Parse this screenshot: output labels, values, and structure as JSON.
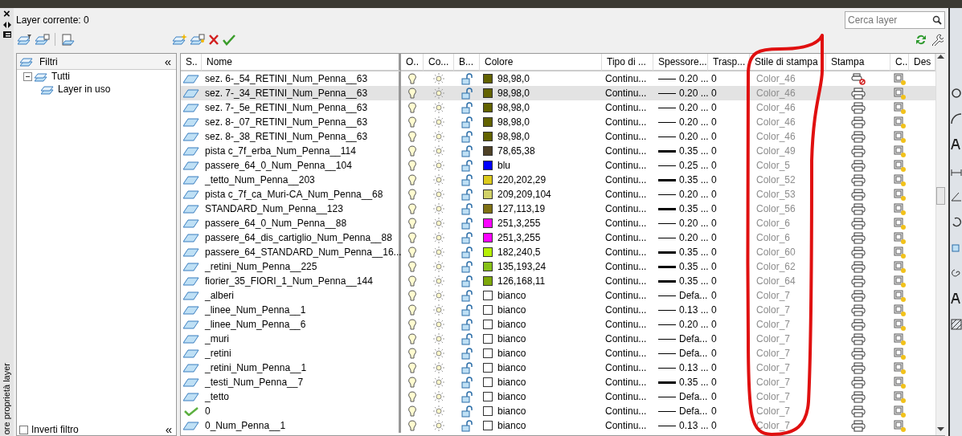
{
  "side_strip": {
    "close": "×",
    "caption": "ore proprietà layer"
  },
  "header": {
    "current_layer": "Layer corrente: 0",
    "search": {
      "placeholder": "Cerca layer"
    }
  },
  "filters": {
    "title": "Filtri",
    "collapse": "«",
    "tree": [
      {
        "label": "Tutti",
        "expanded": true,
        "children": [
          {
            "label": "Layer in uso"
          }
        ]
      }
    ],
    "invert": {
      "label": "Inverti filtro",
      "checked": false,
      "collapse": "«"
    }
  },
  "table": {
    "columns": [
      "S..",
      "Nome",
      "O..",
      "Co...",
      "B...",
      "Colore",
      "Tipo di ...",
      "Spessore...",
      "Trasp...",
      "Stile di stampa",
      "Stampa",
      "C..",
      "Des"
    ],
    "rows": [
      {
        "kind": "layer",
        "name": "sez. 6-_54_RETINI_Num_Penna__63",
        "on": true,
        "frozen": false,
        "locked": false,
        "color": "#626200",
        "color_label": "98,98,0",
        "linetype": "Continu...",
        "line_bold": false,
        "lineweight": "0.20 ...",
        "transparency": "0",
        "plot_style": "Color_46",
        "plot": false,
        "selected": false
      },
      {
        "kind": "layer",
        "name": "sez. 7-_34_RETINI_Num_Penna__63",
        "on": true,
        "frozen": false,
        "locked": false,
        "color": "#626200",
        "color_label": "98,98,0",
        "linetype": "Continu...",
        "line_bold": false,
        "lineweight": "0.20 ...",
        "transparency": "0",
        "plot_style": "Color_46",
        "plot": true,
        "selected": true
      },
      {
        "kind": "layer",
        "name": "sez. 7-_5e_RETINI_Num_Penna__63",
        "on": true,
        "frozen": false,
        "locked": false,
        "color": "#626200",
        "color_label": "98,98,0",
        "linetype": "Continu...",
        "line_bold": false,
        "lineweight": "0.20 ...",
        "transparency": "0",
        "plot_style": "Color_46",
        "plot": true,
        "selected": false
      },
      {
        "kind": "layer",
        "name": "sez. 8-_07_RETINI_Num_Penna__63",
        "on": true,
        "frozen": false,
        "locked": false,
        "color": "#626200",
        "color_label": "98,98,0",
        "linetype": "Continu...",
        "line_bold": false,
        "lineweight": "0.20 ...",
        "transparency": "0",
        "plot_style": "Color_46",
        "plot": true,
        "selected": false
      },
      {
        "kind": "layer",
        "name": "sez. 8-_38_RETINI_Num_Penna__63",
        "on": true,
        "frozen": false,
        "locked": false,
        "color": "#626200",
        "color_label": "98,98,0",
        "linetype": "Continu...",
        "line_bold": false,
        "lineweight": "0.20 ...",
        "transparency": "0",
        "plot_style": "Color_46",
        "plot": true,
        "selected": false
      },
      {
        "kind": "layer",
        "name": "pista c_7f_erba_Num_Penna__114",
        "on": true,
        "frozen": false,
        "locked": false,
        "color": "#4e4126",
        "color_label": "78,65,38",
        "linetype": "Continu...",
        "line_bold": true,
        "lineweight": "0.35 ...",
        "transparency": "0",
        "plot_style": "Color_49",
        "plot": true,
        "selected": false
      },
      {
        "kind": "layer",
        "name": "passere_64_0_Num_Penna__104",
        "on": true,
        "frozen": false,
        "locked": false,
        "color": "#0000ff",
        "color_label": "blu",
        "linetype": "Continu...",
        "line_bold": false,
        "lineweight": "0.25 ...",
        "transparency": "0",
        "plot_style": "Color_5",
        "plot": true,
        "selected": false
      },
      {
        "kind": "layer",
        "name": "_tetto_Num_Penna__203",
        "on": true,
        "frozen": false,
        "locked": false,
        "color": "#dcca1d",
        "color_label": "220,202,29",
        "linetype": "Continu...",
        "line_bold": true,
        "lineweight": "0.35 ...",
        "transparency": "0",
        "plot_style": "Color_52",
        "plot": true,
        "selected": false
      },
      {
        "kind": "layer",
        "name": "pista c_7f_ca_Muri-CA_Num_Penna__68",
        "on": true,
        "frozen": false,
        "locked": false,
        "color": "#d1d168",
        "color_label": "209,209,104",
        "linetype": "Continu...",
        "line_bold": false,
        "lineweight": "0.20 ...",
        "transparency": "0",
        "plot_style": "Color_53",
        "plot": true,
        "selected": false
      },
      {
        "kind": "layer",
        "name": "STANDARD_Num_Penna__123",
        "on": true,
        "frozen": false,
        "locked": false,
        "color": "#7f7113",
        "color_label": "127,113,19",
        "linetype": "Continu...",
        "line_bold": true,
        "lineweight": "0.35 ...",
        "transparency": "0",
        "plot_style": "Color_56",
        "plot": true,
        "selected": false
      },
      {
        "kind": "layer",
        "name": "passere_64_0_Num_Penna__88",
        "on": true,
        "frozen": false,
        "locked": false,
        "color": "#fb03ff",
        "color_label": "251,3,255",
        "linetype": "Continu...",
        "line_bold": false,
        "lineweight": "0.20 ...",
        "transparency": "0",
        "plot_style": "Color_6",
        "plot": true,
        "selected": false
      },
      {
        "kind": "layer",
        "name": "passere_64_dis_cartiglio_Num_Penna__88",
        "on": true,
        "frozen": false,
        "locked": false,
        "color": "#fb03ff",
        "color_label": "251,3,255",
        "linetype": "Continu...",
        "line_bold": false,
        "lineweight": "0.20 ...",
        "transparency": "0",
        "plot_style": "Color_6",
        "plot": true,
        "selected": false
      },
      {
        "kind": "layer",
        "name": "passere_64_STANDARD_Num_Penna__16...",
        "on": true,
        "frozen": false,
        "locked": false,
        "color": "#b6f005",
        "color_label": "182,240,5",
        "linetype": "Continu...",
        "line_bold": true,
        "lineweight": "0.35 ...",
        "transparency": "0",
        "plot_style": "Color_60",
        "plot": true,
        "selected": false
      },
      {
        "kind": "layer",
        "name": "_retini_Num_Penna__225",
        "on": true,
        "frozen": false,
        "locked": false,
        "color": "#87c118",
        "color_label": "135,193,24",
        "linetype": "Continu...",
        "line_bold": true,
        "lineweight": "0.35 ...",
        "transparency": "0",
        "plot_style": "Color_62",
        "plot": true,
        "selected": false
      },
      {
        "kind": "layer",
        "name": "fiorier_35_FIORI_1_Num_Penna__144",
        "on": true,
        "frozen": false,
        "locked": false,
        "color": "#7ea80b",
        "color_label": "126,168,11",
        "linetype": "Continu...",
        "line_bold": true,
        "lineweight": "0.35 ...",
        "transparency": "0",
        "plot_style": "Color_64",
        "plot": true,
        "selected": false
      },
      {
        "kind": "layer",
        "name": "_alberi",
        "on": true,
        "frozen": false,
        "locked": false,
        "color": "#ffffff",
        "color_label": "bianco",
        "linetype": "Continu...",
        "line_bold": false,
        "lineweight": "Defa...",
        "transparency": "0",
        "plot_style": "Color_7",
        "plot": true,
        "selected": false
      },
      {
        "kind": "layer",
        "name": "_linee_Num_Penna__1",
        "on": true,
        "frozen": false,
        "locked": false,
        "color": "#ffffff",
        "color_label": "bianco",
        "linetype": "Continu...",
        "line_bold": false,
        "lineweight": "0.13 ...",
        "transparency": "0",
        "plot_style": "Color_7",
        "plot": true,
        "selected": false
      },
      {
        "kind": "layer",
        "name": "_linee_Num_Penna__6",
        "on": true,
        "frozen": false,
        "locked": false,
        "color": "#ffffff",
        "color_label": "bianco",
        "linetype": "Continu...",
        "line_bold": false,
        "lineweight": "0.20 ...",
        "transparency": "0",
        "plot_style": "Color_7",
        "plot": true,
        "selected": false
      },
      {
        "kind": "layer",
        "name": "_muri",
        "on": true,
        "frozen": false,
        "locked": false,
        "color": "#ffffff",
        "color_label": "bianco",
        "linetype": "Continu...",
        "line_bold": false,
        "lineweight": "Defa...",
        "transparency": "0",
        "plot_style": "Color_7",
        "plot": true,
        "selected": false
      },
      {
        "kind": "layer",
        "name": "_retini",
        "on": true,
        "frozen": false,
        "locked": false,
        "color": "#ffffff",
        "color_label": "bianco",
        "linetype": "Continu...",
        "line_bold": false,
        "lineweight": "Defa...",
        "transparency": "0",
        "plot_style": "Color_7",
        "plot": true,
        "selected": false
      },
      {
        "kind": "layer",
        "name": "_retini_Num_Penna__1",
        "on": true,
        "frozen": false,
        "locked": false,
        "color": "#ffffff",
        "color_label": "bianco",
        "linetype": "Continu...",
        "line_bold": false,
        "lineweight": "0.13 ...",
        "transparency": "0",
        "plot_style": "Color_7",
        "plot": true,
        "selected": false
      },
      {
        "kind": "layer",
        "name": "_testi_Num_Penna__7",
        "on": true,
        "frozen": false,
        "locked": false,
        "color": "#ffffff",
        "color_label": "bianco",
        "linetype": "Continu...",
        "line_bold": true,
        "lineweight": "0.35 ...",
        "transparency": "0",
        "plot_style": "Color_7",
        "plot": true,
        "selected": false
      },
      {
        "kind": "layer",
        "name": "_tetto",
        "on": true,
        "frozen": false,
        "locked": false,
        "color": "#ffffff",
        "color_label": "bianco",
        "linetype": "Continu...",
        "line_bold": false,
        "lineweight": "Defa...",
        "transparency": "0",
        "plot_style": "Color_7",
        "plot": true,
        "selected": false
      },
      {
        "kind": "current",
        "name": "0",
        "on": true,
        "frozen": false,
        "locked": false,
        "color": "#ffffff",
        "color_label": "bianco",
        "linetype": "Continu...",
        "line_bold": false,
        "lineweight": "Defa...",
        "transparency": "0",
        "plot_style": "Color_7",
        "plot": true,
        "selected": false
      },
      {
        "kind": "layer",
        "name": "0_Num_Penna__1",
        "on": true,
        "frozen": false,
        "locked": false,
        "color": "#ffffff",
        "color_label": "bianco",
        "linetype": "Continu...",
        "line_bold": false,
        "lineweight": "0.13 ...",
        "transparency": "0",
        "plot_style": "Color_7",
        "plot": true,
        "selected": false
      }
    ]
  }
}
